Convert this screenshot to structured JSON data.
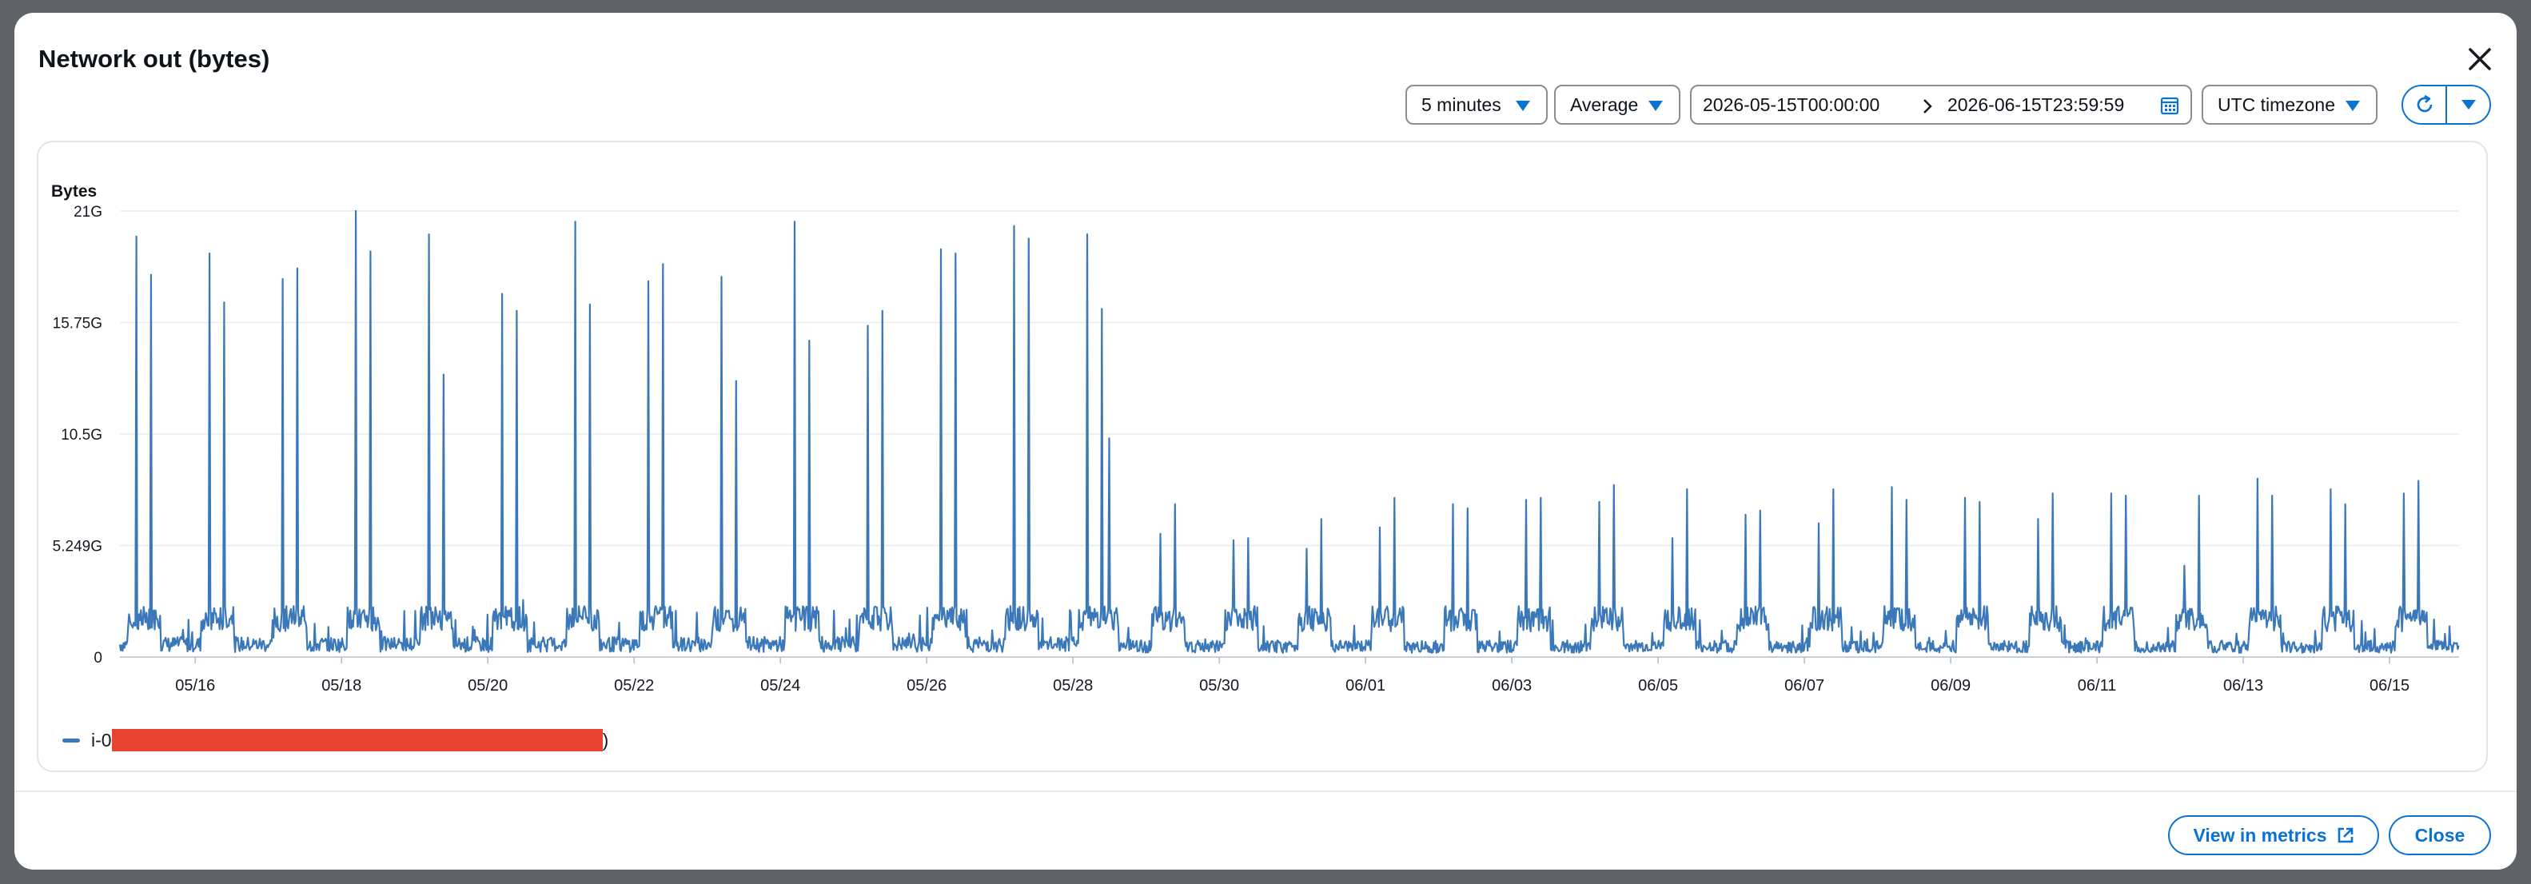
{
  "dialog": {
    "title": "Network out (bytes)",
    "close_icon": "close-icon"
  },
  "toolbar": {
    "period": "5 minutes",
    "statistic": "Average",
    "range_start": "2026-05-15T00:00:00",
    "range_end": "2026-06-15T23:59:59",
    "timezone": "UTC timezone",
    "refresh_icon": "refresh-icon",
    "refresh_menu_icon": "caret-down-icon"
  },
  "chart_data": {
    "type": "line",
    "ylabel": "Bytes",
    "ylim": [
      0,
      21
    ],
    "y_unit": "G",
    "y_ticks": [
      {
        "value": 0,
        "label": "0"
      },
      {
        "value": 5.249,
        "label": "5.249G"
      },
      {
        "value": 10.5,
        "label": "10.5G"
      },
      {
        "value": 15.75,
        "label": "15.75G"
      },
      {
        "value": 21,
        "label": "21G"
      }
    ],
    "x_tick_labels": [
      "05/16",
      "05/18",
      "05/20",
      "05/22",
      "05/24",
      "05/26",
      "05/28",
      "05/30",
      "06/01",
      "06/03",
      "06/05",
      "06/07",
      "06/09",
      "06/11",
      "06/13",
      "06/15"
    ],
    "xlim": [
      "2026-05-15",
      "2026-06-15"
    ],
    "grid": true,
    "series": [
      {
        "name": "i-0",
        "color": "#3b78b9",
        "baseline": 0.6,
        "spikes": [
          {
            "day": 15.2,
            "value": 19.8
          },
          {
            "day": 15.4,
            "value": 18.0
          },
          {
            "day": 16.2,
            "value": 19.0
          },
          {
            "day": 16.4,
            "value": 16.7
          },
          {
            "day": 17.2,
            "value": 17.8
          },
          {
            "day": 17.4,
            "value": 18.3
          },
          {
            "day": 18.2,
            "value": 21.0
          },
          {
            "day": 18.4,
            "value": 19.1
          },
          {
            "day": 19.2,
            "value": 19.9
          },
          {
            "day": 19.4,
            "value": 13.3
          },
          {
            "day": 20.2,
            "value": 17.1
          },
          {
            "day": 20.4,
            "value": 16.3
          },
          {
            "day": 21.2,
            "value": 20.5
          },
          {
            "day": 21.4,
            "value": 16.6
          },
          {
            "day": 22.2,
            "value": 17.7
          },
          {
            "day": 22.4,
            "value": 18.5
          },
          {
            "day": 23.2,
            "value": 17.9
          },
          {
            "day": 23.4,
            "value": 13.0
          },
          {
            "day": 24.2,
            "value": 20.5
          },
          {
            "day": 24.4,
            "value": 14.9
          },
          {
            "day": 25.2,
            "value": 15.6
          },
          {
            "day": 25.4,
            "value": 16.3
          },
          {
            "day": 26.2,
            "value": 19.2
          },
          {
            "day": 26.4,
            "value": 19.0
          },
          {
            "day": 27.2,
            "value": 20.3
          },
          {
            "day": 27.4,
            "value": 19.7
          },
          {
            "day": 28.2,
            "value": 19.9
          },
          {
            "day": 28.4,
            "value": 16.4
          },
          {
            "day": 28.5,
            "value": 10.3
          },
          {
            "day": 29.2,
            "value": 5.8
          },
          {
            "day": 29.4,
            "value": 7.2
          },
          {
            "day": 30.2,
            "value": 5.5
          },
          {
            "day": 30.4,
            "value": 5.6
          },
          {
            "day": 31.2,
            "value": 5.1
          },
          {
            "day": 31.4,
            "value": 6.5
          },
          {
            "day": 32.2,
            "value": 6.1
          },
          {
            "day": 32.4,
            "value": 7.5
          },
          {
            "day": 33.2,
            "value": 7.2
          },
          {
            "day": 33.4,
            "value": 7.0
          },
          {
            "day": 34.2,
            "value": 7.4
          },
          {
            "day": 34.4,
            "value": 7.5
          },
          {
            "day": 35.2,
            "value": 7.3
          },
          {
            "day": 35.4,
            "value": 8.1
          },
          {
            "day": 36.2,
            "value": 5.6
          },
          {
            "day": 36.4,
            "value": 7.9
          },
          {
            "day": 37.2,
            "value": 6.7
          },
          {
            "day": 37.4,
            "value": 6.9
          },
          {
            "day": 38.2,
            "value": 6.3
          },
          {
            "day": 38.4,
            "value": 7.9
          },
          {
            "day": 39.2,
            "value": 8.0
          },
          {
            "day": 39.4,
            "value": 7.4
          },
          {
            "day": 40.2,
            "value": 7.5
          },
          {
            "day": 40.4,
            "value": 7.3
          },
          {
            "day": 41.2,
            "value": 6.5
          },
          {
            "day": 41.4,
            "value": 7.7
          },
          {
            "day": 42.2,
            "value": 7.7
          },
          {
            "day": 42.4,
            "value": 7.6
          },
          {
            "day": 43.2,
            "value": 4.3
          },
          {
            "day": 43.4,
            "value": 7.6
          },
          {
            "day": 44.2,
            "value": 8.4
          },
          {
            "day": 44.4,
            "value": 7.6
          },
          {
            "day": 45.2,
            "value": 7.9
          },
          {
            "day": 45.4,
            "value": 7.2
          },
          {
            "day": 46.2,
            "value": 7.7
          },
          {
            "day": 46.4,
            "value": 8.3
          }
        ]
      }
    ]
  },
  "legend": {
    "items": [
      {
        "prefix": "i-0",
        "suffix": ")",
        "color": "#3b78b9",
        "redaction_color": "#e8432e"
      }
    ]
  },
  "footer": {
    "view_in_metrics": "View in metrics",
    "close": "Close",
    "external_icon": "external-link-icon"
  }
}
